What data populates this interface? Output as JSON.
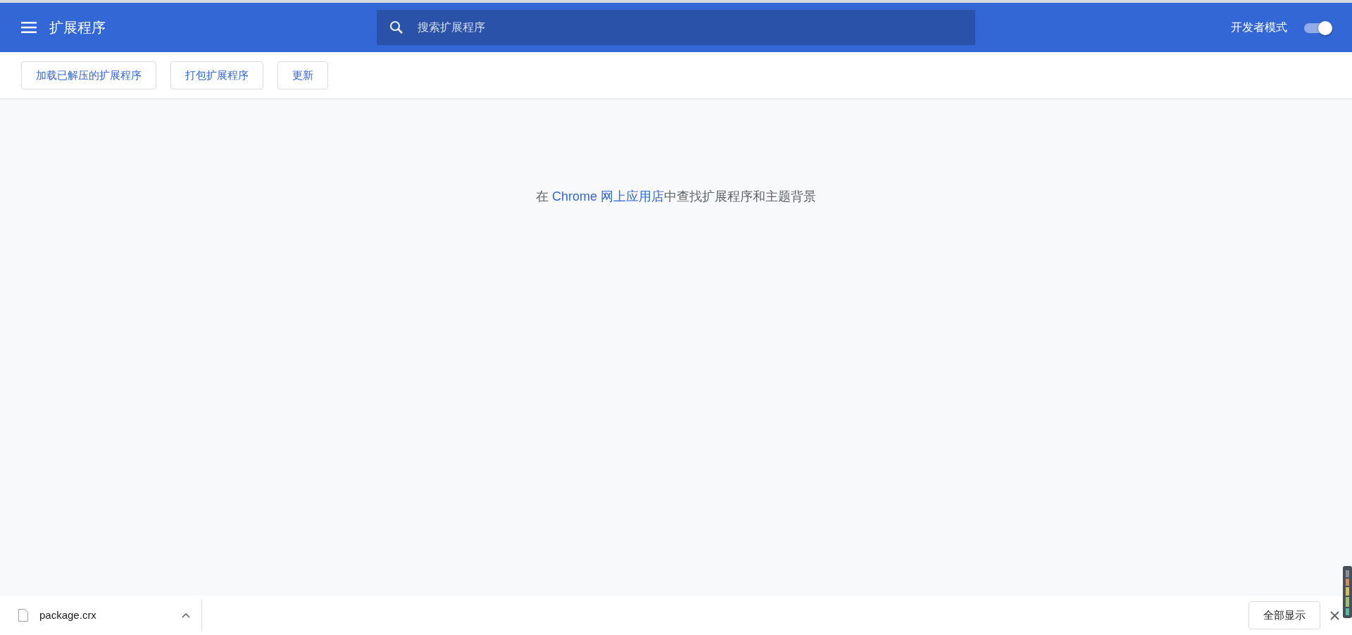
{
  "header": {
    "title": "扩展程序",
    "search": {
      "placeholder": "搜索扩展程序"
    },
    "dev_mode": {
      "label": "开发者模式",
      "on": true
    }
  },
  "toolbar": {
    "buttons": [
      "加载已解压的扩展程序",
      "打包扩展程序",
      "更新"
    ]
  },
  "message": {
    "prefix": "在 ",
    "link": "Chrome 网上应用店",
    "suffix": "中查找扩展程序和主题背景"
  },
  "download_bar": {
    "file": "package.crx",
    "show_all": "全部显示"
  }
}
